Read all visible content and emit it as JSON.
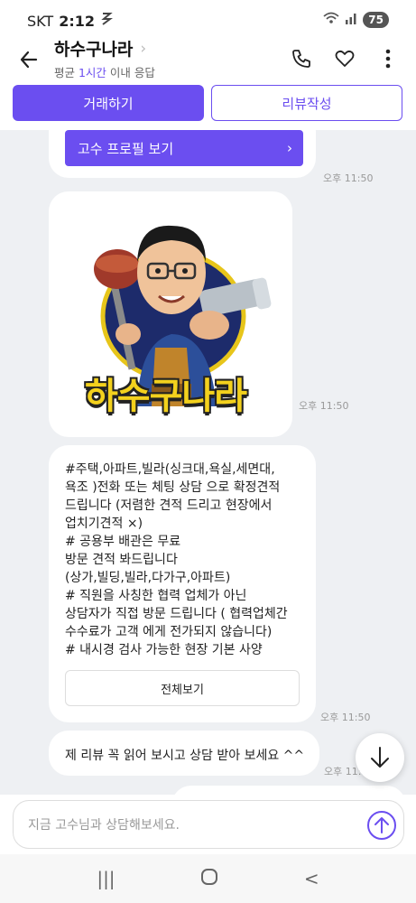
{
  "status": {
    "carrier": "SKT",
    "time": "2:12",
    "battery": "75"
  },
  "header": {
    "title": "하수구나라",
    "subtitle_prefix": "평균 ",
    "subtitle_highlight": "1시간",
    "subtitle_suffix": " 이내 응답"
  },
  "actions": {
    "deal": "거래하기",
    "review": "리뷰작성"
  },
  "chat": {
    "profile_button": "고수 프로필 보기",
    "logo_text": "하수구나라",
    "message": "#주택,아파트,빌라(싱크대,욕실,세면대,\n욕조 )전화 또는 체팅 상담 으로 확정견적\n드립니다 (저렴한 견적 드리고 현장에서\n업치기견적 ×)\n# 공용부 배관은 무료\n방문 견적 봐드립니다\n(상가,빌딩,빌라,다가구,아파트)\n# 직원을 사칭한 협력 업체가 아닌\n상담자가 직접 방문 드립니다 ( 협력업체간\n수수료가 고객 에게 전가되지 않습니다)\n# 내시경 검사 가능한 현장 기본 사양",
    "full_view": "전체보기",
    "short_message": "제 리뷰 꼭 읽어 보시고 상담 받아 보세요 ^^",
    "times": [
      "오후 11:50",
      "오후 11:50",
      "오후 11:50",
      "오후 11:50"
    ]
  },
  "input": {
    "placeholder": "지금 고수님과 상담해보세요."
  },
  "nav": {
    "recent": "|||",
    "home": "○",
    "back": "<"
  }
}
